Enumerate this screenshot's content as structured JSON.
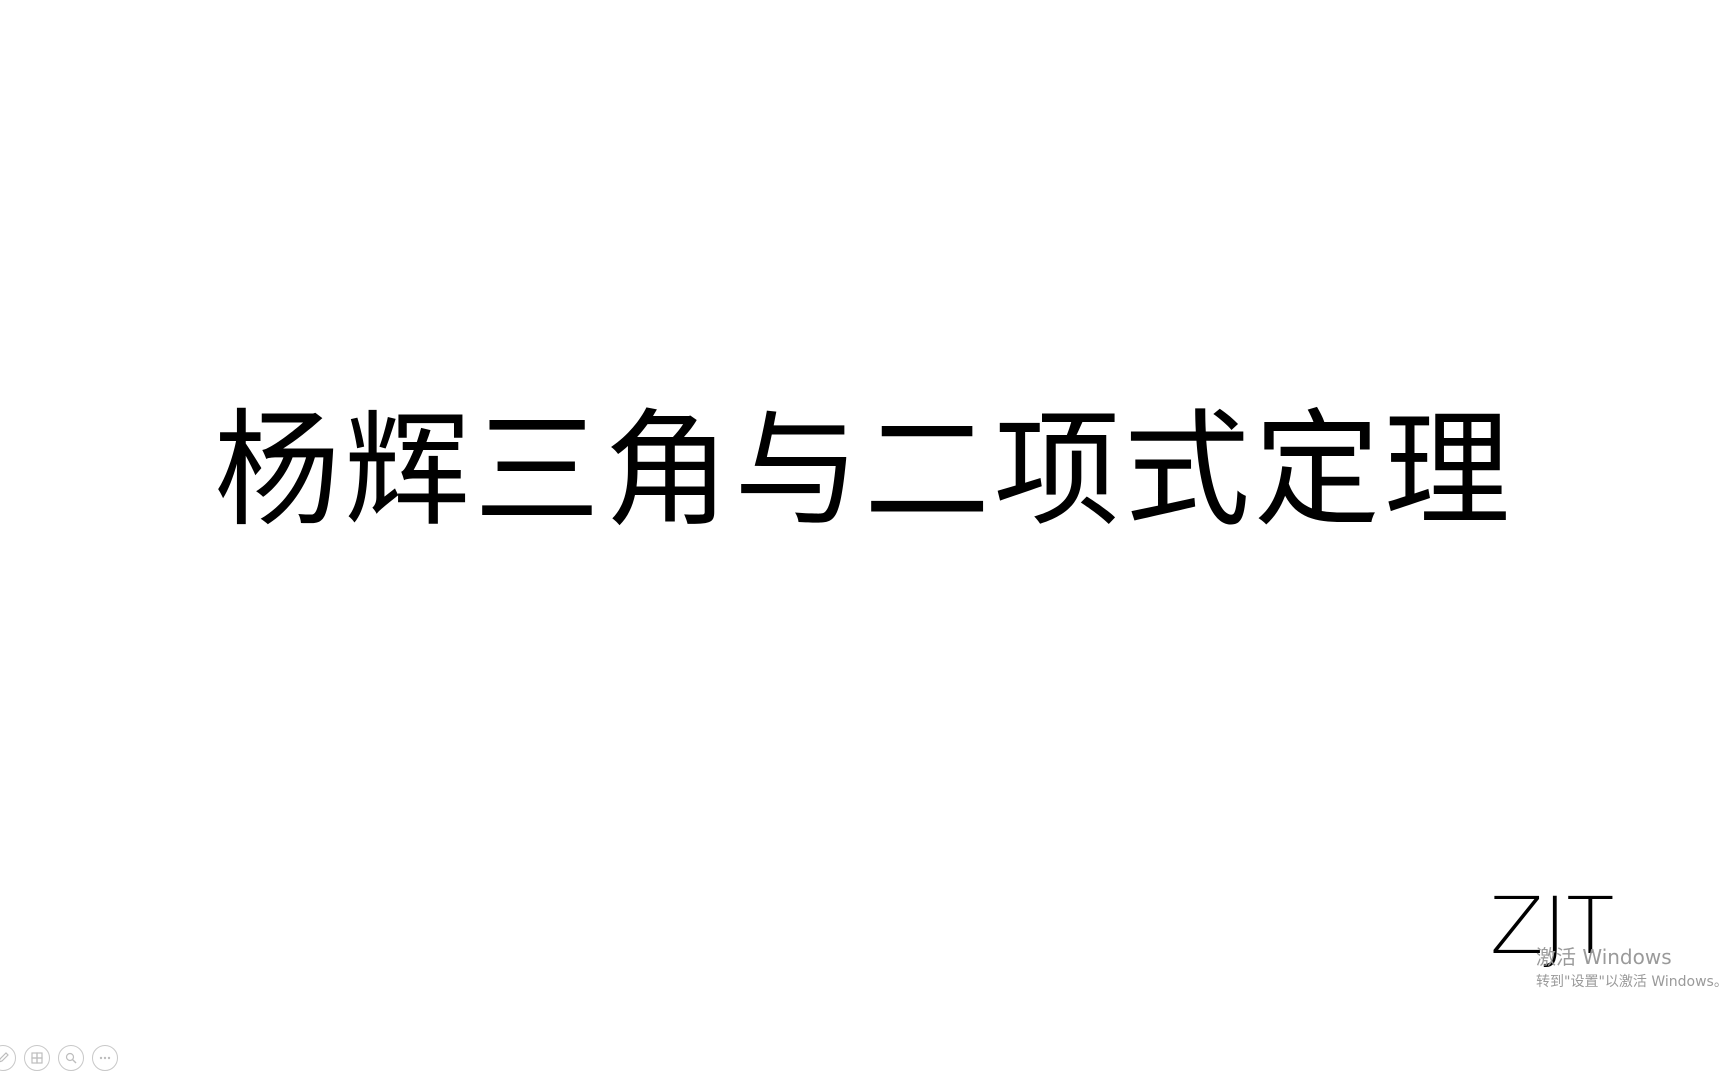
{
  "slide": {
    "title": "杨辉三角与二项式定理",
    "author": "ZJT"
  },
  "watermark": {
    "line1": "激活 Windows",
    "line2": "转到\"设置\"以激活 Windows。"
  },
  "controls": [
    {
      "icon": "pen-icon"
    },
    {
      "icon": "slides-icon"
    },
    {
      "icon": "zoom-icon"
    },
    {
      "icon": "more-icon"
    }
  ]
}
